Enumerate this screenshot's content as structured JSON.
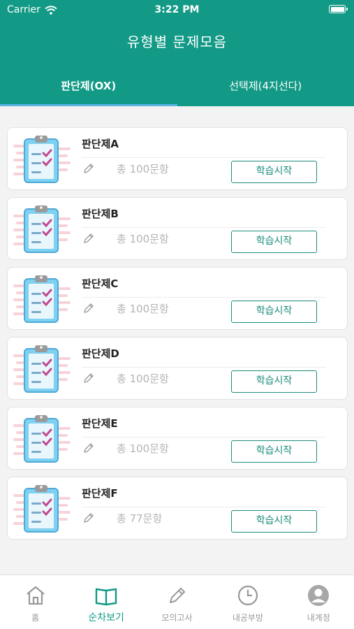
{
  "status": {
    "carrier": "Carrier",
    "time": "3:22 PM"
  },
  "header": {
    "title": "유형별 문제모음"
  },
  "tabs": [
    {
      "label": "판단제(OX)",
      "active": true
    },
    {
      "label": "선택제(4지선다)",
      "active": false
    }
  ],
  "cards": [
    {
      "title": "판단제A",
      "count": "총 100문항",
      "button": "학습시작"
    },
    {
      "title": "판단제B",
      "count": "총 100문항",
      "button": "학습시작"
    },
    {
      "title": "판단제C",
      "count": "총 100문항",
      "button": "학습시작"
    },
    {
      "title": "판단제D",
      "count": "총 100문항",
      "button": "학습시작"
    },
    {
      "title": "판단제E",
      "count": "총 100문항",
      "button": "학습시작"
    },
    {
      "title": "판단제F",
      "count": "총 77문항",
      "button": "학습시작"
    }
  ],
  "bottom_nav": [
    {
      "label": "홈",
      "icon": "home-icon",
      "active": false
    },
    {
      "label": "순차보기",
      "icon": "book-icon",
      "active": true
    },
    {
      "label": "모의고사",
      "icon": "pencil-icon",
      "active": false
    },
    {
      "label": "내공부방",
      "icon": "clock-icon",
      "active": false
    },
    {
      "label": "내계정",
      "icon": "user-icon",
      "active": false
    }
  ],
  "colors": {
    "accent": "#129a86",
    "tab_indicator": "#5bb3e6",
    "button": "#1b8c7c"
  }
}
